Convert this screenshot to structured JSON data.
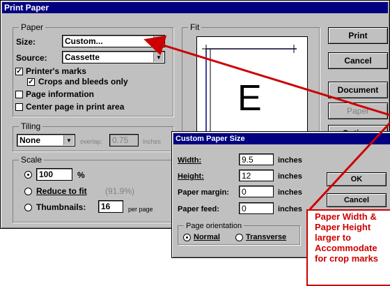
{
  "print_dialog": {
    "title": "Print Paper",
    "paper_group": {
      "label": "Paper",
      "size_label": "Size:",
      "size_value": "Custom...",
      "source_label": "Source:",
      "source_value": "Cassette",
      "printers_marks": "Printer's marks",
      "crops_bleeds": "Crops and bleeds only",
      "page_information": "Page information",
      "center_page": "Center page in print area"
    },
    "tiling_group": {
      "label": "Tiling",
      "mode_value": "None",
      "overlap_label": "overlap:",
      "overlap_value": "0.75",
      "overlap_unit": "inches"
    },
    "scale_group": {
      "label": "Scale",
      "percent_value": "100",
      "percent_unit": "%",
      "reduce_label": "Reduce to fit",
      "reduce_value": "(91.9%)",
      "thumbnails_label": "Thumbnails:",
      "thumbnails_value": "16",
      "thumbnails_unit": "per page"
    },
    "fit_group": {
      "label": "Fit",
      "preview_letter": "E"
    },
    "buttons": {
      "print": "Print",
      "cancel": "Cancel",
      "document": "Document",
      "paper": "Paper",
      "options": "Options"
    }
  },
  "custom_dialog": {
    "title": "Custom Paper Size",
    "width_label": "Width:",
    "width_value": "9.5",
    "height_label": "Height:",
    "height_value": "12",
    "margin_label": "Paper margin:",
    "margin_value": "0",
    "feed_label": "Paper feed:",
    "feed_value": "0",
    "unit": "inches",
    "orientation_label": "Page orientation",
    "normal_label": "Normal",
    "transverse_label": "Transverse",
    "ok": "OK",
    "cancel": "Cancel"
  },
  "callout": {
    "text": "Paper Width &\nPaper Height\nlarger to\nAccommodate\nfor crop marks",
    "color": "#cc0000"
  },
  "arrow_color": "#cc0000"
}
